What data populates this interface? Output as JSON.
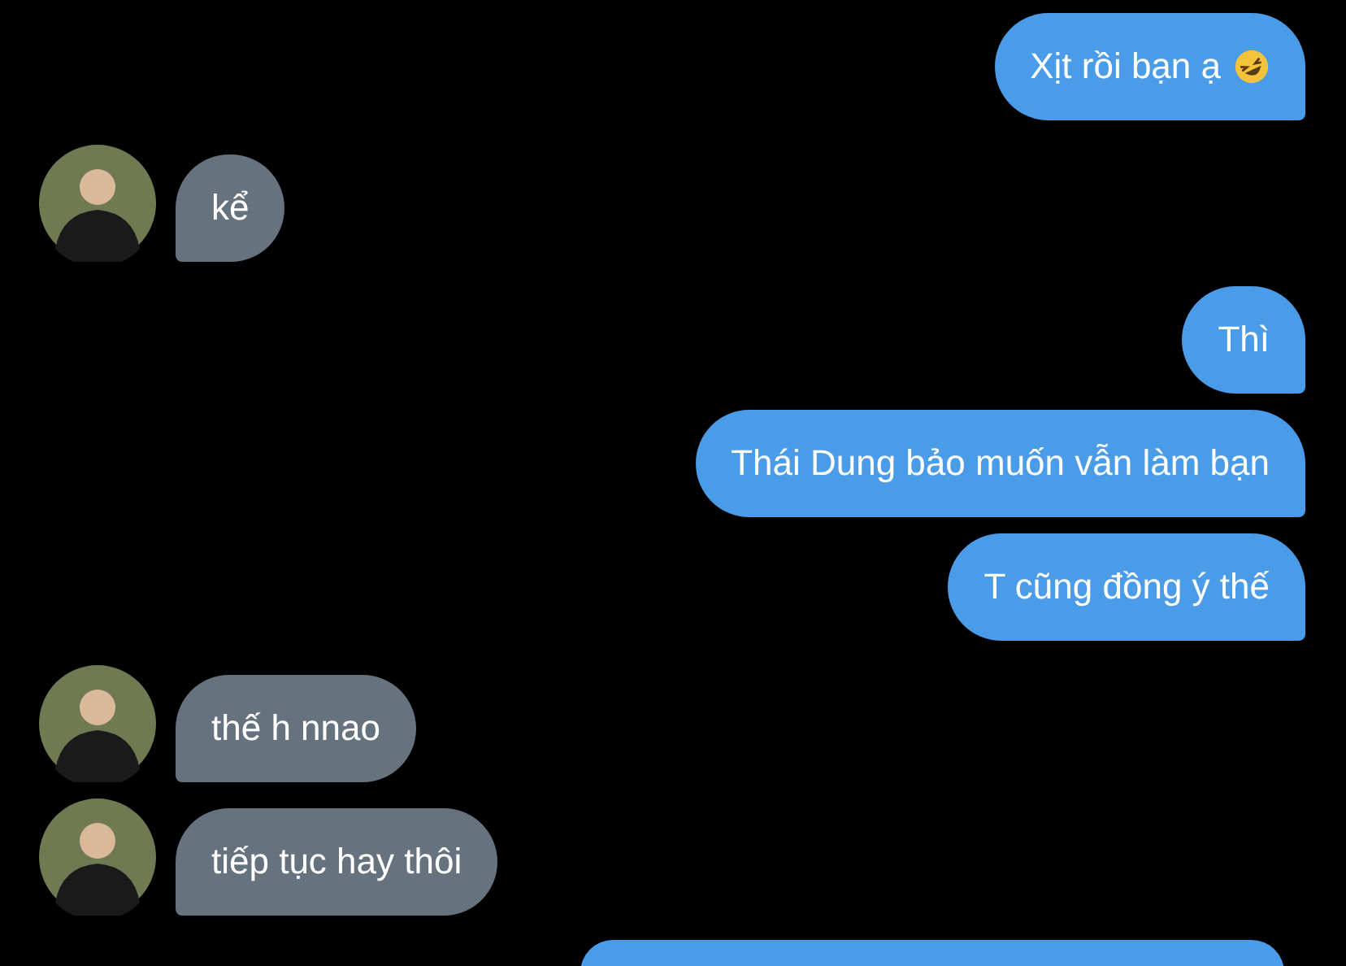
{
  "messages": [
    {
      "kind": "outgoing",
      "text": "Xịt rồi bạn ạ",
      "emoji_icon": true
    },
    {
      "kind": "incoming",
      "text": "kể"
    },
    {
      "kind": "outgoing",
      "text": "Thì"
    },
    {
      "kind": "outgoing",
      "text": "Thái Dung bảo muốn vẫn làm bạn"
    },
    {
      "kind": "outgoing",
      "text": "T cũng đồng ý thế"
    },
    {
      "kind": "incoming",
      "text": "thế h nnao"
    },
    {
      "kind": "incoming",
      "text": "tiếp tục hay thôi"
    },
    {
      "kind": "outgoing"
    }
  ]
}
